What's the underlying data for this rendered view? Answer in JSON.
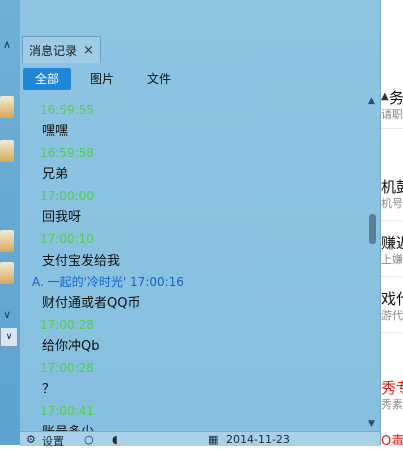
{
  "tab": {
    "label": "消息记录",
    "close": "×"
  },
  "filters": [
    {
      "label": "全部",
      "active": true
    },
    {
      "label": "图片",
      "active": false
    },
    {
      "label": "文件",
      "active": false
    }
  ],
  "messages": [
    {
      "kind": "ts",
      "text": "16:59:55"
    },
    {
      "kind": "tx",
      "text": "嘿嘿"
    },
    {
      "kind": "ts",
      "text": "16:59:58"
    },
    {
      "kind": "tx",
      "text": "兄弟"
    },
    {
      "kind": "ts",
      "text": "17:00:00"
    },
    {
      "kind": "tx",
      "text": "回我呀"
    },
    {
      "kind": "ts",
      "text": "17:00:10"
    },
    {
      "kind": "tx",
      "text": "支付宝发给我"
    },
    {
      "kind": "sender",
      "text": "A. 一起的'冷时光' 17:00:16"
    },
    {
      "kind": "tx",
      "text": "财付通或者QQ币"
    },
    {
      "kind": "ts",
      "text": "17:00:28"
    },
    {
      "kind": "tx",
      "text": "给你冲Qb"
    },
    {
      "kind": "ts",
      "text": "17:00:28"
    },
    {
      "kind": "tx",
      "text": "？"
    },
    {
      "kind": "ts",
      "text": "17:00:41"
    },
    {
      "kind": "tx",
      "text": "账号多少"
    }
  ],
  "bottombar": {
    "settings": "设置",
    "date": "2014-11-23"
  },
  "right_partial": [
    {
      "title": "务处",
      "sub": "请职"
    },
    {
      "title": "机鼓",
      "sub": "机号"
    },
    {
      "title": "赚返",
      "sub": "上嫌"
    },
    {
      "title": "戏代",
      "sub": "游代"
    },
    {
      "title": "秀专",
      "sub": "秀素"
    },
    {
      "title": "Q毒",
      "sub": ""
    }
  ],
  "icons": {
    "chevron_up": "∧",
    "chevron_down": "∨",
    "scroll_up": "▲",
    "scroll_down": "▼"
  },
  "colors": {
    "panel": "#8ec4e2",
    "active_filter": "#1e88d6",
    "timestamp": "#4fd14a",
    "sender": "#1264c8",
    "accent_red": "#e02020"
  }
}
